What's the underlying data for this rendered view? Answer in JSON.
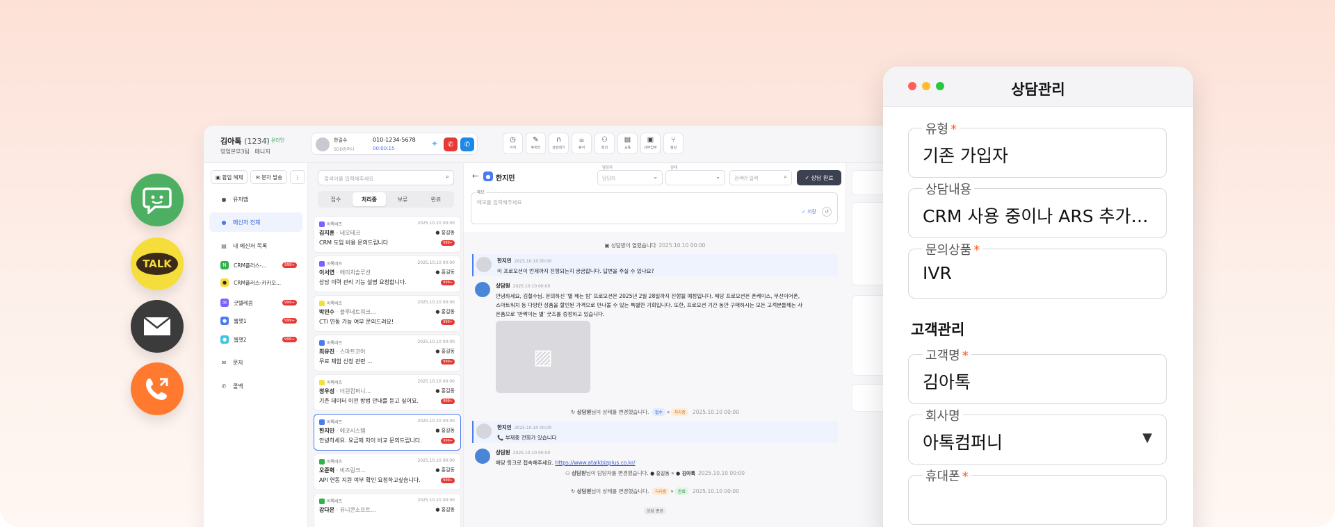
{
  "side_icons": [
    {
      "name": "sms-icon",
      "color": "#4caf62"
    },
    {
      "name": "kakaotalk-icon",
      "label": "TALK",
      "color": "#f5dd3c"
    },
    {
      "name": "mail-icon",
      "color": "#3b3b3b"
    },
    {
      "name": "callback-icon",
      "color": "#ff7a2f"
    }
  ],
  "topbar": {
    "user_name": "김아톡",
    "user_id": "(1234)",
    "status": "온라인",
    "department": "영업본부3팀",
    "role": "매니저",
    "call": {
      "name": "한길수",
      "company": "SDD컴퍼니",
      "number": "010-1234-5678",
      "timer": "00:00:15"
    },
    "tools": [
      "이석",
      "후처리",
      "상담대기",
      "휴식",
      "회의",
      "교육",
      "내부업무",
      "점심"
    ]
  },
  "nav": {
    "buttons": [
      "팝업 해제",
      "문자 발송"
    ],
    "items": [
      {
        "label": "유저맵",
        "icon": "user-icon"
      },
      {
        "label": "메신저 전체",
        "icon": "chat-icon",
        "active": true
      },
      {
        "label": "내 메신저 목록",
        "icon": "list-icon"
      }
    ],
    "channels": [
      {
        "label": "CRM플러스-...",
        "color": "#2fb34a",
        "glyph": "N",
        "badge": "999+"
      },
      {
        "label": "CRM플러스-카카오...",
        "color": "#f5dd3c",
        "glyph": "●",
        "badge": ""
      },
      {
        "label": "굿텔레콤",
        "color": "#7b61ff",
        "glyph": "✉",
        "badge": "999+"
      },
      {
        "label": "웹챗1",
        "color": "#4a7cf0",
        "glyph": "●",
        "badge": "999+"
      },
      {
        "label": "웹챗2",
        "color": "#3cc6e6",
        "glyph": "●",
        "badge": "999+"
      }
    ],
    "bottom": [
      {
        "label": "문자",
        "icon": "mail-icon"
      },
      {
        "label": "콜백",
        "icon": "phone-icon"
      }
    ]
  },
  "list": {
    "search_placeholder": "검색어를 입력해주세요",
    "tabs": [
      "접수",
      "처리중",
      "보류",
      "완료"
    ],
    "active_tab": 1,
    "cards": [
      {
        "channel": "아톡비즈",
        "ch_color": "#7b61ff",
        "date": "2025.10.10 00:00",
        "name": "김지훈",
        "company": "· 네오테크",
        "agent": "홍길동",
        "msg": "CRM 도입 비용 문의드립니다",
        "badge": "999+"
      },
      {
        "channel": "아톡비즈",
        "ch_color": "#7b61ff",
        "date": "2025.10.10 00:00",
        "name": "이서연",
        "company": "· 에이치솔루션",
        "agent": "홍길동",
        "msg": "상담 이력 관리 기능 설명 요청합니다.",
        "badge": "999+"
      },
      {
        "channel": "아톡비즈",
        "ch_color": "#f5dd3c",
        "date": "2025.10.10 00:00",
        "name": "박민수",
        "company": "· 블루네트워크...",
        "agent": "홍길동",
        "msg": "CTI 연동 가능 여부 문의드려요!",
        "badge": "999+"
      },
      {
        "channel": "아톡비즈",
        "ch_color": "#4a7cf0",
        "date": "2025.10.10 00:00",
        "name": "최유진",
        "company": "· 스마트코어",
        "agent": "홍길동",
        "msg": "무료 체험 신청 관련 ...",
        "badge": "999+"
      },
      {
        "channel": "아톡비즈",
        "ch_color": "#f5dd3c",
        "date": "2025.10.10 00:00",
        "name": "정우성",
        "company": "· 더원컴퍼니...",
        "agent": "홍길동",
        "msg": "기존 데이터 이전 방법 안내를 듣고 싶어요.",
        "badge": "999+"
      },
      {
        "channel": "아톡비즈",
        "ch_color": "#4a7cf0",
        "date": "2025.10.10 00:00",
        "name": "한지민",
        "company": "· 에코시스템",
        "agent": "홍길동",
        "msg": "안녕하세요. 요금제 차이 비교 문의드립니다.",
        "badge": "999+",
        "selected": true
      },
      {
        "channel": "아톡비즈",
        "ch_color": "#2fb34a",
        "date": "2025.10.10 00:00",
        "name": "오준혁",
        "company": "· 비즈링크...",
        "agent": "홍길동",
        "msg": "API 연동 지원 여부 확인 요청하고싶습니다.",
        "badge": "999+"
      },
      {
        "channel": "아톡비즈",
        "ch_color": "#2fb34a",
        "date": "2025.10.10 00:00",
        "name": "강다은",
        "company": "· 유니콘소프트...",
        "agent": "홍길동",
        "msg": "",
        "badge": ""
      }
    ]
  },
  "chat": {
    "title": "한지민",
    "agent_label": "담당자",
    "agent_placeholder": "담당자",
    "status_label": "상태",
    "search_placeholder": "검색어 입력",
    "done_button": "상담 완료",
    "memo_label": "메모",
    "memo_placeholder": "메모를 입력해주세요",
    "memo_save": "저장",
    "opened": "상담방이 열렸습니다",
    "opened_time": "2025.10.10 00:00",
    "msg1": {
      "name": "한지민",
      "time": "2025.10.10 00:00",
      "text": "이 프로모션이 언제까지 진행되는지 궁금합니다. 답변을 주실 수 있나요?"
    },
    "msg2": {
      "name": "상담원",
      "time": "2025.10.10 00:00",
      "lines": [
        "안녕하세요, 김철수님. 문의하신 '별 헤는 밤' 프로모션은 2025년 2월 28일까지 진행될 예정입니다. 해당 프로모션은 폰케이스, 무선이어폰,",
        "스마트워치 등 다양한 상품을 할인된 가격으로 만나볼 수 있는 특별한 기회입니다. 또한, 프로모션 기간 동안 구매하시는 모든 고객분들께는 사",
        "은품으로 '반짝이는 별' 굿즈를 증정하고 있습니다."
      ]
    },
    "status_change1": {
      "who": "상담원",
      "text": "님이 상태를 변경했습니다.",
      "from": "접수",
      "to": "처리중",
      "time": "2025.10.10 00:00"
    },
    "msg3": {
      "name": "한지민",
      "time": "2025.10.10 00:00",
      "text": "부재중 전화가 있습니다",
      "prefix": "📞"
    },
    "msg4": {
      "name": "상담원",
      "time": "2025.10.10 00:00",
      "text": "해당 링크로 접속해주세요.",
      "link": "https://www.atalkbizplus.co.kr/"
    },
    "agent_change": {
      "who": "상담원",
      "text": "님이 담당자를 변경했습니다.",
      "from": "홍길동",
      "to": "김아톡",
      "time": "2025.10.10 00:00"
    },
    "status_change2": {
      "who": "상담원",
      "text": "님이 상태를 변경했습니다.",
      "from": "처리중",
      "to": "완료",
      "time": "2025.10.10 00:00"
    },
    "closed": "상담 종료"
  },
  "modal": {
    "title": "상담관리",
    "fields_top": [
      {
        "label": "유형",
        "required": true,
        "value": "기존 가입자"
      },
      {
        "label": "상담내용",
        "required": false,
        "value": "CRM 사용 중이나 ARS 추가 도입을 검토 중입니다"
      },
      {
        "label": "문의상품",
        "required": true,
        "value": "IVR"
      }
    ],
    "section": "고객관리",
    "fields_bottom": [
      {
        "label": "고객명",
        "required": true,
        "value": "김아톡"
      },
      {
        "label": "회사명",
        "required": false,
        "value": "아톡컴퍼니",
        "dropdown": true
      },
      {
        "label": "휴대폰",
        "required": true,
        "value": ""
      }
    ]
  }
}
